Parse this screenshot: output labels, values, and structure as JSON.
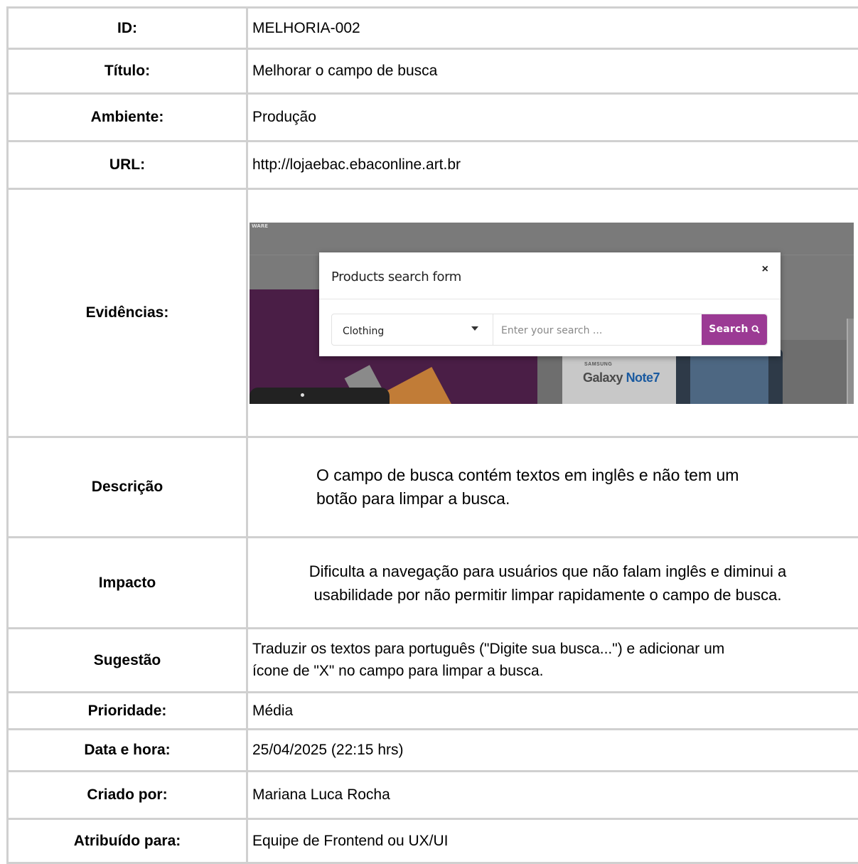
{
  "rows": {
    "id": {
      "label": "ID:",
      "value": "MELHORIA-002"
    },
    "titulo": {
      "label": "Título:",
      "value": "Melhorar o campo de busca"
    },
    "ambiente": {
      "label": "Ambiente:",
      "value": "Produção"
    },
    "url": {
      "label": "URL:",
      "value": "http://lojaebac.ebaconline.art.br"
    },
    "evidencias": {
      "label": "Evidências:"
    },
    "descricao": {
      "label": "Descrição",
      "line1": "O campo de busca contém textos em inglês e não tem um",
      "line2": "botão para limpar a busca."
    },
    "impacto": {
      "label": "Impacto",
      "line1": "Dificulta a navegação para usuários que não falam inglês e diminui a",
      "line2": "usabilidade por não permitir limpar rapidamente o campo de busca."
    },
    "sugestao": {
      "label": "Sugestão",
      "line1": "Traduzir os textos para português (\"Digite sua busca...\") e adicionar um",
      "line2": "ícone de \"X\" no campo para limpar a busca."
    },
    "prioridade": {
      "label": "Prioridade:",
      "value": "Média"
    },
    "data_hora": {
      "label": "Data e hora:",
      "value": "25/04/2025 (22:15 hrs)"
    },
    "criado_por": {
      "label": "Criado por:",
      "value": "Mariana Luca Rocha"
    },
    "atribuido": {
      "label": "Atribuído para:",
      "value": "Equipe de Frontend ou UX/UI"
    }
  },
  "evidence": {
    "site_fragment": "WARE",
    "modal_title": "Products search form",
    "close_glyph": "×",
    "category_value": "Clothing",
    "search_placeholder": "Enter your search ...",
    "search_button": "Search",
    "banner_brand": "SAMSUNG",
    "banner_product": "Galaxy",
    "banner_model": "Note7",
    "colors": {
      "button": "#9b3a94",
      "purple_banner": "#4a1e46",
      "overlay": "#7a7a7a"
    }
  }
}
